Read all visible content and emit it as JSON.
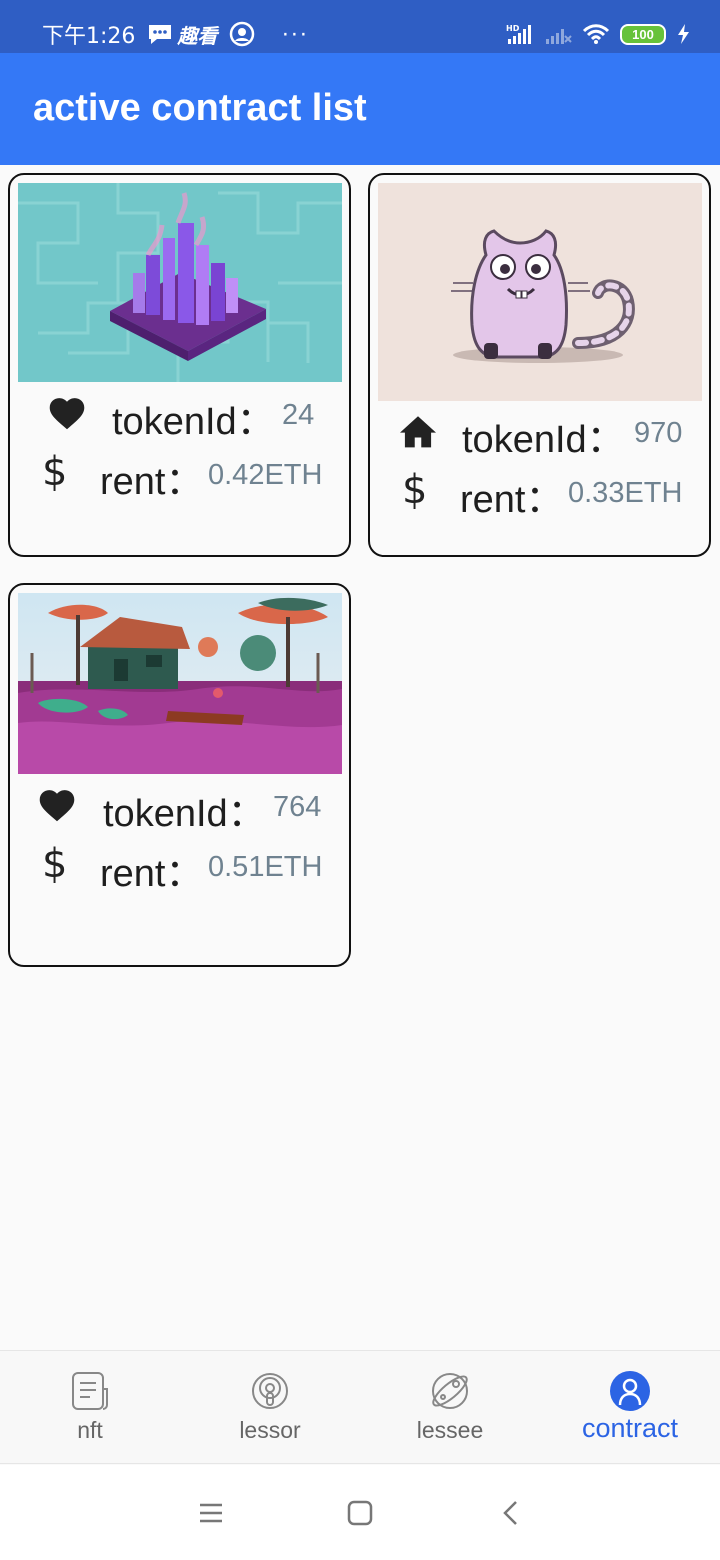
{
  "status_bar": {
    "time": "下午1:26",
    "app_text": "趣看",
    "more": "···",
    "network": "HD",
    "battery": "100"
  },
  "app_bar": {
    "title": "active contract list"
  },
  "contracts": [
    {
      "icon": "heart-icon",
      "token_label": "tokenId：",
      "token_id": "24",
      "rent_label": "rent：",
      "rent": "0.42ETH",
      "image": "purple-city-artwork"
    },
    {
      "icon": "home-icon",
      "token_label": "tokenId：",
      "token_id": "970",
      "rent_label": "rent：",
      "rent": "0.33ETH",
      "image": "cryptokitty-cat"
    },
    {
      "icon": "heart-icon",
      "token_label": "tokenId：",
      "token_id": "764",
      "rent_label": "rent：",
      "rent": "0.51ETH",
      "image": "forest-house-landscape"
    }
  ],
  "bottom_nav": {
    "items": [
      {
        "label": "nft",
        "icon": "document-icon"
      },
      {
        "label": "lessor",
        "icon": "podcast-icon"
      },
      {
        "label": "lessee",
        "icon": "planet-icon"
      },
      {
        "label": "contract",
        "icon": "user-icon"
      }
    ],
    "active": "contract",
    "active_color": "#2c64e4"
  },
  "colors": {
    "status_bar": "#2f5ec4",
    "app_bar": "#3478f6",
    "value_text": "#6f8290"
  }
}
